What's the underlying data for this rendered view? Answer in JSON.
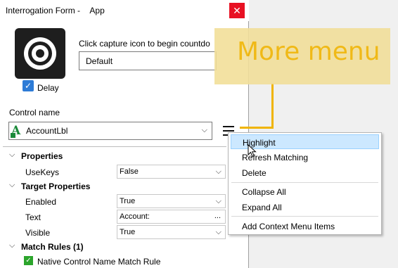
{
  "window": {
    "title": "Interrogation Form -",
    "app_label": "App",
    "close_symbol": "✕"
  },
  "capture": {
    "icon": "target-icon",
    "instruction": "Click capture icon to begin countdo",
    "mode_value": "Default",
    "delay_label": "Delay",
    "delay_checked": true
  },
  "control": {
    "label": "Control name",
    "value": "AccountLbl",
    "type_icon": "label-control-icon"
  },
  "properties": {
    "groups": [
      {
        "title": "Properties",
        "items": [
          {
            "name": "UseKeys",
            "value": "False",
            "editor": "dropdown"
          }
        ]
      },
      {
        "title": "Target Properties",
        "items": [
          {
            "name": "Enabled",
            "value": "True",
            "editor": "dropdown"
          },
          {
            "name": "Text",
            "value": "Account:",
            "editor": "ellipsis"
          },
          {
            "name": "Visible",
            "value": "True",
            "editor": "dropdown"
          }
        ]
      },
      {
        "title": "Match Rules (1)",
        "items": [
          {
            "name": "Native Control Name Match Rule",
            "checked": true
          }
        ]
      }
    ]
  },
  "context_menu": {
    "items": [
      "Highlight",
      "Refresh Matching",
      "Delete",
      "Collapse All",
      "Expand All",
      "Add Context Menu Items"
    ],
    "highlighted": "Highlight"
  },
  "callout": {
    "text": "More menu",
    "color": "#f0b400",
    "background": "#f2df9a"
  }
}
